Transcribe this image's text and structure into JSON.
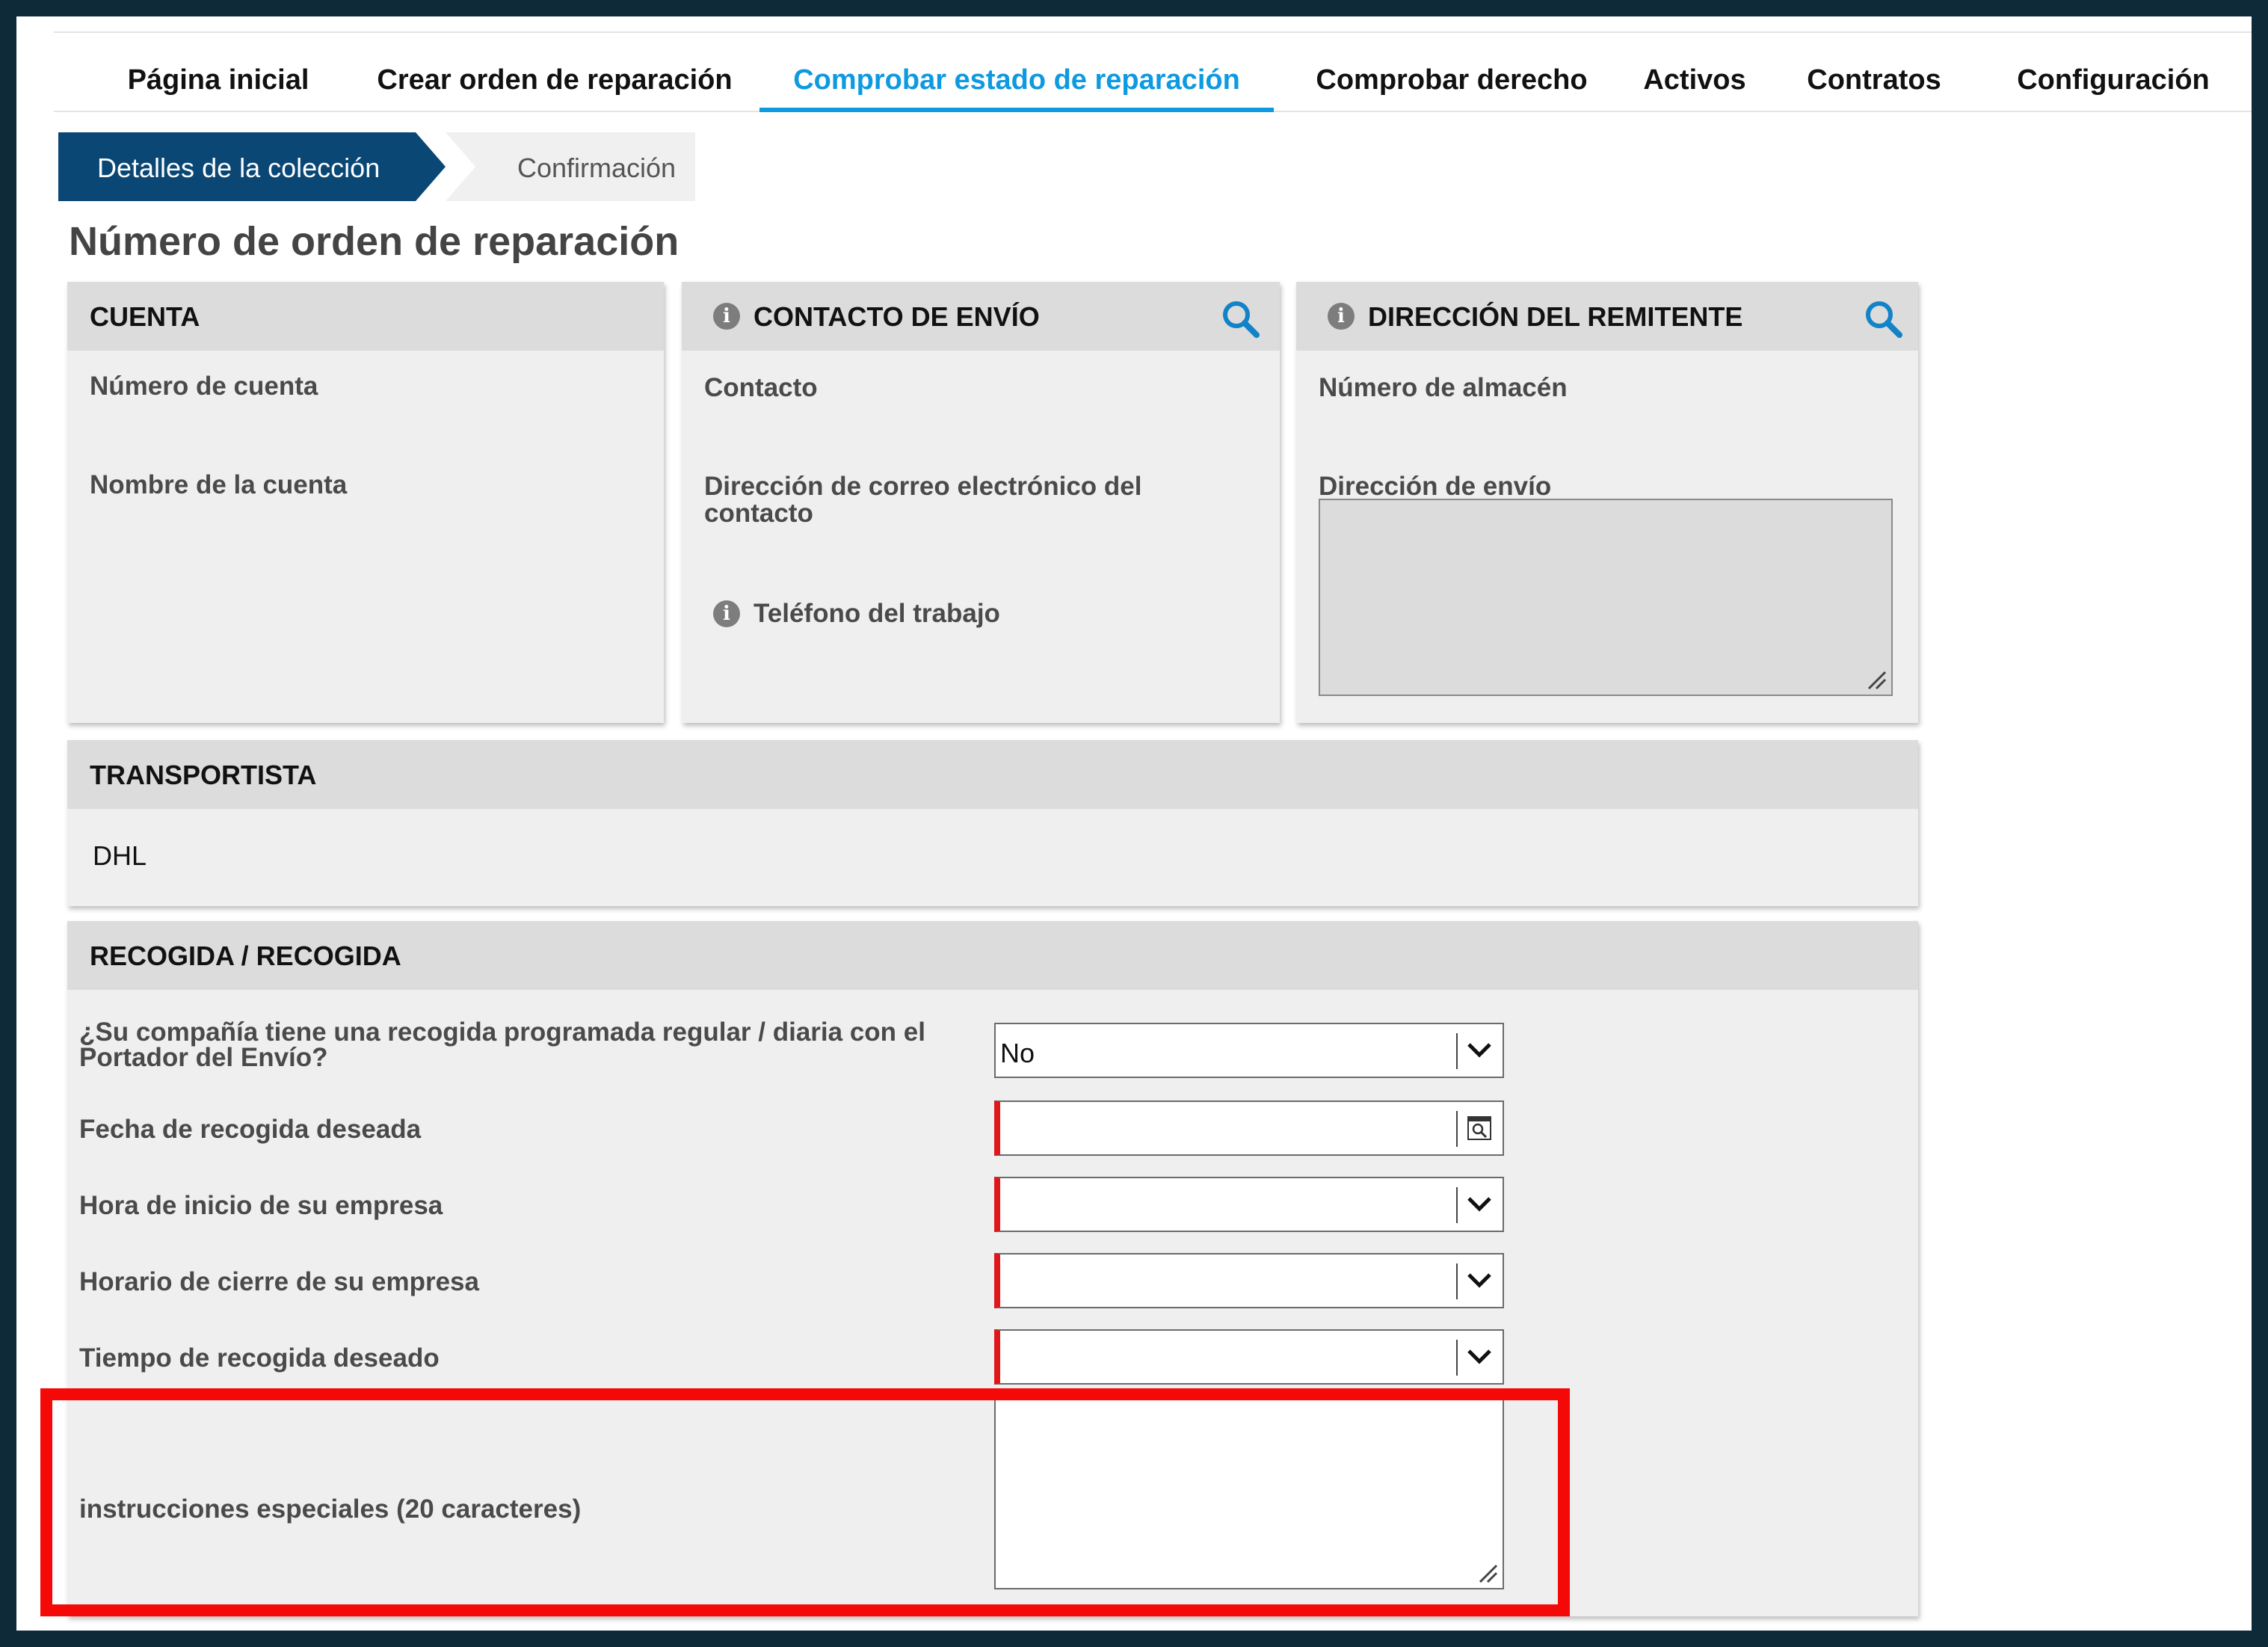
{
  "nav": {
    "tabs": [
      {
        "label": "Página inicial"
      },
      {
        "label": "Crear orden de reparación"
      },
      {
        "label": "Comprobar estado de reparación"
      },
      {
        "label": "Comprobar derecho"
      },
      {
        "label": "Activos"
      },
      {
        "label": "Contratos"
      },
      {
        "label": "Configuración"
      }
    ],
    "active_index": 2
  },
  "stepper": {
    "steps": [
      {
        "label": "Detalles de la colección",
        "state": "active"
      },
      {
        "label": "Confirmación",
        "state": "inactive"
      }
    ]
  },
  "page_title": "Número de orden de reparación",
  "account_card": {
    "title": "CUENTA",
    "fields": [
      "Número de cuenta",
      "Nombre de la cuenta"
    ]
  },
  "contact_card": {
    "title": "CONTACTO DE ENVÍO",
    "contact_label": "Contacto",
    "email_label": "Dirección de correo electrónico del contacto",
    "phone_label": "Teléfono del trabajo"
  },
  "sender_card": {
    "title": "DIRECCIÓN DEL REMITENTE",
    "warehouse_label": "Número de almacén",
    "shipping_address_label": "Dirección de envío",
    "shipping_address_value": ""
  },
  "carrier_card": {
    "title": "TRANSPORTISTA",
    "value": "DHL"
  },
  "pickup_card": {
    "title": "RECOGIDA / RECOGIDA",
    "scheduled_pickup": {
      "label": "¿Su compañía tiene una recogida programada regular / diaria con el Portador del Envío?",
      "value": "No"
    },
    "pickup_date": {
      "label": "Fecha de recogida deseada",
      "value": ""
    },
    "start_time": {
      "label": "Hora de inicio de su empresa",
      "value": ""
    },
    "close_time": {
      "label": "Horario de cierre de su empresa",
      "value": ""
    },
    "pickup_time": {
      "label": "Tiempo de recogida deseado",
      "value": ""
    },
    "special_instructions": {
      "label": "instrucciones especiales (20 caracteres)",
      "value": ""
    }
  },
  "colors": {
    "accent": "#0e9ae0",
    "step_active": "#0a4775",
    "required": "#e0161b",
    "highlight": "#f40808",
    "card_bg": "#efefef",
    "card_header": "#dcdcdc"
  }
}
